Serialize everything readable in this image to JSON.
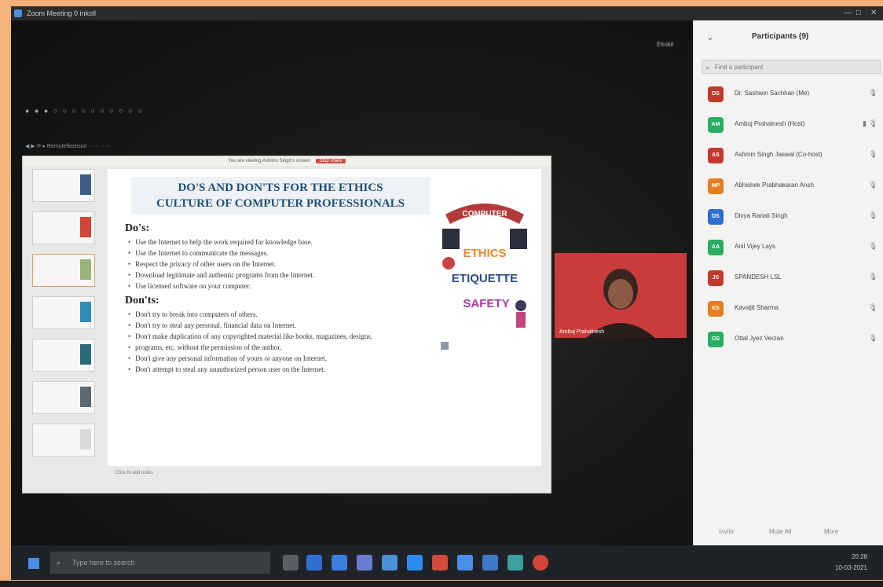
{
  "window": {
    "title": "Zoom Meeting 0 inkoll",
    "controls": [
      "—",
      "□",
      "✕"
    ]
  },
  "stage": {
    "recording": "Ekokil",
    "faint_toolbar": "● ● ● ○ ○ ○ ○ ○ ○ ○ ○ ○ ○",
    "faint_url": "◀ ▶ ⟳ ▸ Remoteflashsurl ··· ·· ·· ··"
  },
  "slide_window": {
    "banner": "You are viewing Ashmin Singh's screen",
    "banner_stop": "Stop share",
    "slide": {
      "title_line1": "DO'S AND DON'TS FOR THE ETHICS",
      "title_line2": "CULTURE OF COMPUTER PROFESSIONALS",
      "dos_heading": "Do's:",
      "dos": [
        "Use the Internet to help the work required for knowledge base.",
        "Use the Internet to communicate the messages.",
        "Respect the privacy of other users on the Internet.",
        "Download legitimate and authentic programs from the Internet.",
        "Use licensed software on your computer."
      ],
      "donts_heading": "Don'ts:",
      "donts": [
        "Don't try to break into computers of others.",
        "Don't try to steal any personal, financial data on Internet.",
        "Don't make duplication of any copyrighted material like books, magazines, designs,",
        "programs, etc. without the permission of the author.",
        "Don't give any personal information of yours or anyone on Internet.",
        "Don't attempt to steal any unauthorized person user on the Internet."
      ],
      "art": {
        "ribbon": "COMPUTER",
        "line1": "ETHICS",
        "line2": "ETIQUETTE",
        "line3": "SAFETY"
      }
    },
    "footer_note": "Click to add notes"
  },
  "presenter": {
    "name": "Ambuj Prahalnesh"
  },
  "participants_panel": {
    "title": "Participants (9)",
    "search_placeholder": "Find a participant",
    "participants": [
      {
        "initials": "DS",
        "name": "Dr. Sashwin Sachhan (Me)",
        "color": "#c0392b"
      },
      {
        "initials": "AM",
        "name": "Ambuj Prahalnesh (Host)",
        "color": "#27ae60"
      },
      {
        "initials": "AS",
        "name": "Ashmin Singh Jaswal (Co-host)",
        "color": "#c0392b"
      },
      {
        "initials": "MP",
        "name": "Abhishek Prabhakaran Ansh",
        "color": "#e67e22"
      },
      {
        "initials": "DS",
        "name": "Divya Ranali Singh",
        "color": "#2f6fd1"
      },
      {
        "initials": "AA",
        "name": "Anil Vijey Lays",
        "color": "#27ae60"
      },
      {
        "initials": "JS",
        "name": "SPANDESH LSL",
        "color": "#c0392b"
      },
      {
        "initials": "KS",
        "name": "Kavaljit Sharma",
        "color": "#e67e22"
      },
      {
        "initials": "OS",
        "name": "Ottal Jyez Verzan",
        "color": "#27ae60"
      }
    ],
    "footer": [
      "Invite",
      "Mute All",
      "More"
    ]
  },
  "taskbar": {
    "search_placeholder": "Type here to search",
    "time": "20:28",
    "date": "10-03-2021"
  }
}
